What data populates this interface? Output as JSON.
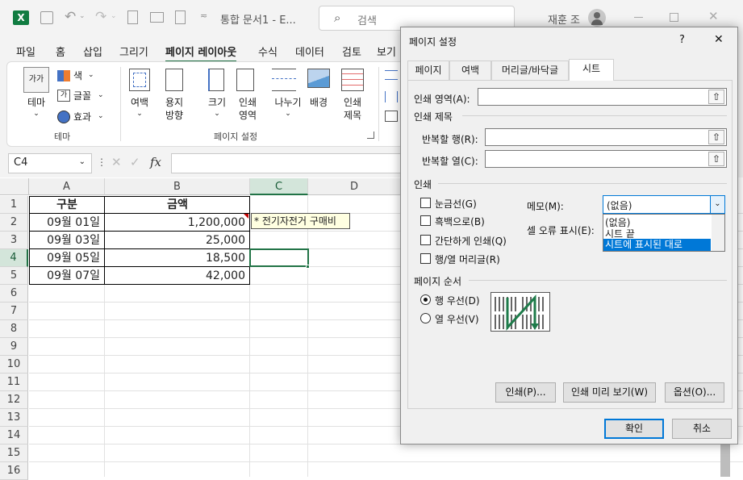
{
  "titlebar": {
    "doc_title": "통합 문서1 - E...",
    "search_placeholder": "검색",
    "user_name": "재훈 조"
  },
  "menu": [
    "파일",
    "홈",
    "삽입",
    "그리기",
    "페이지 레이아웃",
    "수식",
    "데이터",
    "검토",
    "보기"
  ],
  "ribbon": {
    "theme": {
      "theme_label": "테마",
      "color_label": "색",
      "font_label": "글꼴",
      "effect_label": "효과",
      "group_label": "테마"
    },
    "setup_buttons": [
      "여백",
      "용지\n방향",
      "크기",
      "인쇄\n영역",
      "나누기",
      "배경",
      "인쇄\n제목"
    ],
    "setup_group_label": "페이지 설정"
  },
  "formula": {
    "namebox": "C4",
    "fx": "fx"
  },
  "sheet": {
    "columns": [
      "A",
      "B",
      "C",
      "D"
    ],
    "rows": [
      "1",
      "2",
      "3",
      "4",
      "5",
      "6",
      "7",
      "8",
      "9",
      "10",
      "11",
      "12",
      "13",
      "14",
      "15",
      "16"
    ],
    "header": {
      "a": "구분",
      "b": "금액"
    },
    "data": [
      {
        "a": "09월 01일",
        "b": "1,200,000"
      },
      {
        "a": "09월 03일",
        "b": "25,000"
      },
      {
        "a": "09월 05일",
        "b": "18,500"
      },
      {
        "a": "09월 07일",
        "b": "42,000"
      }
    ],
    "comment": "* 전기자전거 구매비"
  },
  "dialog": {
    "title": "페이지 설정",
    "help": "?",
    "close": "✕",
    "tabs": [
      "페이지",
      "여백",
      "머리글/바닥글",
      "시트"
    ],
    "print_area_label": "인쇄 영역(A):",
    "print_titles_label": "인쇄 제목",
    "rows_repeat_label": "반복할 행(R):",
    "cols_repeat_label": "반복할 열(C):",
    "print_label": "인쇄",
    "gridlines": "눈금선(G)",
    "blackwhite": "흑백으로(B)",
    "draft": "간단하게 인쇄(Q)",
    "headings": "행/열 머리글(R)",
    "comments_label": "메모(M):",
    "comments_value": "(없음)",
    "errors_label": "셀 오류 표시(E):",
    "dropdown_options": [
      "(없음)",
      "시트 끝",
      "시트에 표시된 대로"
    ],
    "page_order_label": "페이지 순서",
    "down_then_over": "행 우선(D)",
    "over_then_down": "열 우선(V)",
    "print_btn": "인쇄(P)...",
    "preview_btn": "인쇄 미리 보기(W)",
    "options_btn": "옵션(O)...",
    "ok_btn": "확인",
    "cancel_btn": "취소"
  }
}
